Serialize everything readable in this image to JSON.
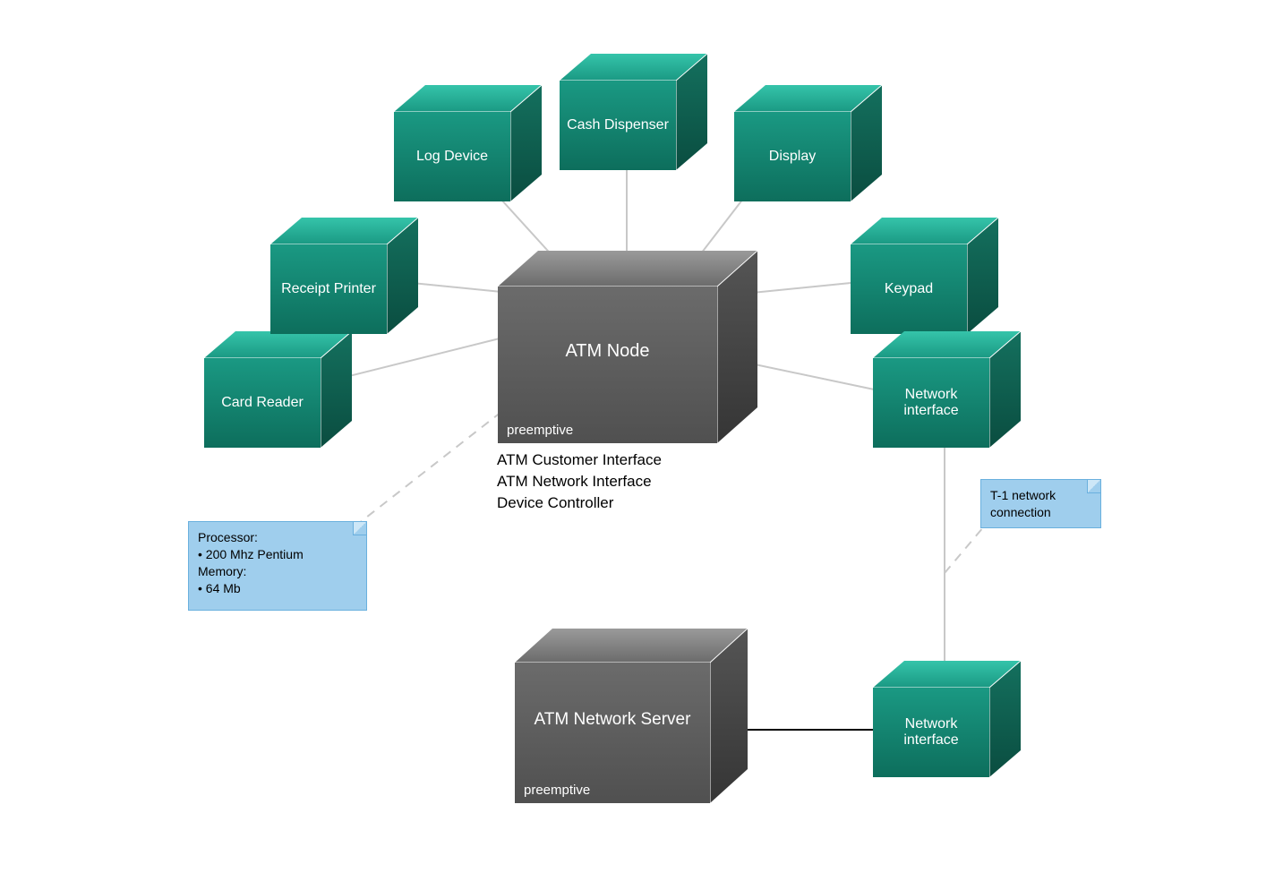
{
  "nodes": {
    "atm_node": {
      "label": "ATM Node",
      "sublabel": "preemptive"
    },
    "atm_network_server": {
      "label": "ATM Network Server",
      "sublabel": "preemptive"
    },
    "card_reader": {
      "label": "Card Reader"
    },
    "receipt_printer": {
      "label": "Receipt Printer"
    },
    "log_device": {
      "label": "Log Device"
    },
    "cash_dispenser": {
      "label": "Cash Dispenser"
    },
    "display": {
      "label": "Display"
    },
    "keypad": {
      "label": "Keypad"
    },
    "network_interface_top": {
      "label": "Network interface"
    },
    "network_interface_bottom": {
      "label": "Network interface"
    }
  },
  "notes": {
    "processor": {
      "line1": "Processor:",
      "line2": "• 200 Mhz Pentium",
      "line3": "Memory:",
      "line4": "• 64 Mb"
    },
    "t1": {
      "line1": "T-1 network",
      "line2": "connection"
    }
  },
  "caption": {
    "line1": "ATM Customer Interface",
    "line2": "ATM Network Interface",
    "line3": "Device Controller"
  }
}
